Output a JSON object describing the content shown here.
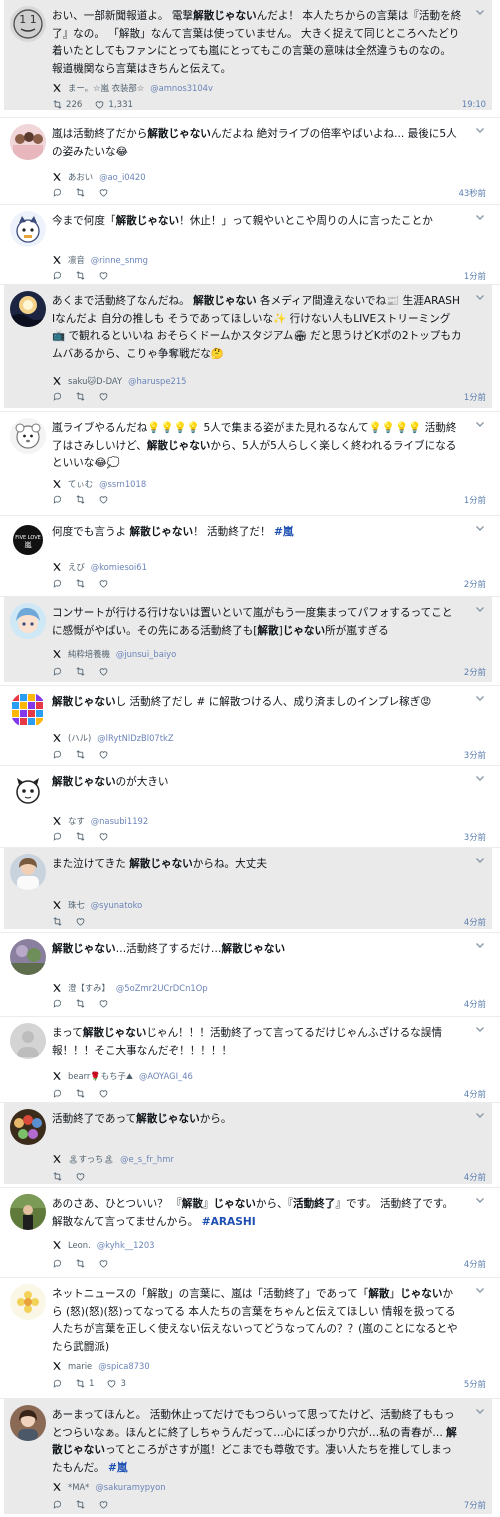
{
  "colors": {
    "shade": "#eaeaea",
    "link": "#1d4fb3",
    "handle": "#6b84b8",
    "time": "#5b7fb0",
    "muted": "#536471"
  },
  "posts": [
    {
      "shaded": true,
      "avatar_icon": "speech-face-avatar",
      "segments": [
        {
          "t": "おい、一部新聞報道よ。 電撃"
        },
        {
          "t": "解散じゃない",
          "b": true
        },
        {
          "t": "んだよ！ 本人たちからの言葉は『活動を終了』なの。 「解散」なんて言葉は使っていません。 大きく捉えて同じところへたどり着いたとしてもファンにとっても嵐にとってもこの言葉の意味は全然違うものなの。 報道機関なら言葉はきちんと伝えて。"
        }
      ],
      "name": "まー。☆嵐 衣装部☆",
      "handle": "@amnos3104v",
      "retweets": "226",
      "likes": "1,331",
      "time": "19:10",
      "show_reply": false
    },
    {
      "shaded": false,
      "avatar_icon": "group-photo-avatar",
      "segments": [
        {
          "t": "嵐は活動終了だから"
        },
        {
          "t": "解散じゃない",
          "b": true
        },
        {
          "t": "んだよね 絶対ライブの倍率やばいよね... 最後に5人の姿みたいな😂"
        }
      ],
      "name": "あおい",
      "handle": "@ao_i0420",
      "retweets": "",
      "likes": "",
      "time": "43秒前",
      "show_reply": true
    },
    {
      "shaded": false,
      "avatar_icon": "cartoon-character-avatar",
      "segments": [
        {
          "t": "今まで何度「"
        },
        {
          "t": "解散じゃない",
          "b": true
        },
        {
          "t": "！休止！」って親やいとこや周りの人に言ったことか"
        }
      ],
      "name": "凛音",
      "handle": "@rinne_snmg",
      "retweets": "",
      "likes": "",
      "time": "1分前",
      "show_reply": true
    },
    {
      "shaded": true,
      "avatar_icon": "sunset-silhouette-avatar",
      "segments": [
        {
          "t": "あくまで活動終了なんだね。 "
        },
        {
          "t": "解散じゃない",
          "b": true
        },
        {
          "t": " 各メディア間違えないでね📰 生涯ARASHIなんだよ 自分の推しも そうであってほしいな✨ 行けない人もLIVEストリーミング📺 で観れるといいね おそらくドームかスタジアム🏟 だと思うけどKポの2トップもカムバあるから、こりゃ争奪戦だな🤔"
        }
      ],
      "name": "saku🐱D-DAY",
      "handle": "@haruspe215",
      "retweets": "",
      "likes": "",
      "time": "1分前",
      "show_reply": true
    },
    {
      "shaded": false,
      "avatar_icon": "plush-character-avatar",
      "segments": [
        {
          "t": "嵐ライブやるんだね💡💡💡💡 5人で集まる姿がまた見れるなんて💡💡💡💡 活動終了はさみしいけど、"
        },
        {
          "t": "解散じゃない",
          "b": true
        },
        {
          "t": "から、5人が5人らしく楽しく終われるライブになるといいな😂💭"
        }
      ],
      "name": "てぃむ",
      "handle": "@ssrn1018",
      "retweets": "",
      "likes": "",
      "time": "1分前",
      "show_reply": true
    },
    {
      "shaded": false,
      "avatar_icon": "logo-text-avatar",
      "segments": [
        {
          "t": "何度でも言うよ "
        },
        {
          "t": "解散じゃない",
          "b": true
        },
        {
          "t": "！ 活動終了だ！ "
        },
        {
          "t": "#嵐",
          "l": true
        }
      ],
      "name": "えび",
      "handle": "@komiesoi61",
      "retweets": "",
      "likes": "",
      "time": "2分前",
      "show_reply": true
    },
    {
      "shaded": true,
      "avatar_icon": "anime-character-avatar",
      "segments": [
        {
          "t": "コンサートが行ける行けないは置いといて嵐がもう一度集まってパフォするってことに感慨がやばい。その先にある活動終了も["
        },
        {
          "t": "解散",
          "b": true
        },
        {
          "t": "]"
        },
        {
          "t": "じゃない",
          "b": true
        },
        {
          "t": "所が嵐すぎる"
        }
      ],
      "name": "純粋培養機",
      "handle": "@junsui_baiyo",
      "retweets": "",
      "likes": "",
      "time": "2分前",
      "show_reply": true
    },
    {
      "shaded": false,
      "avatar_icon": "color-grid-avatar",
      "segments": [
        {
          "t": "解散じゃない",
          "b": true
        },
        {
          "t": "し 活動終了だし # に解散つける人、成り済ましのインプレ稼ぎ😡"
        }
      ],
      "name": "(ハル)",
      "handle": "@lRytNlDzBl07tkZ",
      "retweets": "",
      "likes": "",
      "time": "3分前",
      "show_reply": true
    },
    {
      "shaded": false,
      "avatar_icon": "animal-sketch-avatar",
      "segments": [
        {
          "t": "解散じゃない",
          "b": true
        },
        {
          "t": "のが大きい"
        }
      ],
      "name": "なす",
      "handle": "@nasubi1192",
      "retweets": "",
      "likes": "",
      "time": "3分前",
      "show_reply": true
    },
    {
      "shaded": true,
      "avatar_icon": "person-photo-avatar",
      "segments": [
        {
          "t": "また泣けてきた "
        },
        {
          "t": "解散じゃない",
          "b": true
        },
        {
          "t": "からね。大丈夫"
        }
      ],
      "name": "珠七",
      "handle": "@syunatoko",
      "retweets": "",
      "likes": "",
      "time": "4分前",
      "show_reply": false
    },
    {
      "shaded": false,
      "avatar_icon": "nature-photo-avatar",
      "segments": [
        {
          "t": "解散じゃない",
          "b": true
        },
        {
          "t": "…活動終了するだけ…"
        },
        {
          "t": "解散じゃない",
          "b": true
        }
      ],
      "name": "澄【すみ】",
      "handle": "@5oZmr2UCrDCn1Op",
      "retweets": "",
      "likes": "",
      "time": "4分前",
      "show_reply": true
    },
    {
      "shaded": false,
      "avatar_icon": "default-gray-avatar",
      "segments": [
        {
          "t": "まって"
        },
        {
          "t": "解散じゃない",
          "b": true
        },
        {
          "t": "じゃん！！！活動終了って言ってるだけじゃんふざけるな誤情報！！！そこ大事なんだぞ！！！！！"
        }
      ],
      "name": "bearr🌹もち子⛰",
      "handle": "@AOYAGI_46",
      "retweets": "",
      "likes": "",
      "time": "4分前",
      "show_reply": true
    },
    {
      "shaded": true,
      "avatar_icon": "group-collage-avatar",
      "segments": [
        {
          "t": "活動終了であって"
        },
        {
          "t": "解散じゃない",
          "b": true
        },
        {
          "t": "から。"
        }
      ],
      "name": "🏝すっち🏝",
      "handle": "@e_s_fr_hmr",
      "retweets": "",
      "likes": "",
      "time": "4分前",
      "show_reply": false
    },
    {
      "shaded": false,
      "avatar_icon": "outdoor-photo-avatar",
      "segments": [
        {
          "t": "あのさあ、ひとついい？ 『"
        },
        {
          "t": "解散",
          "b": true
        },
        {
          "t": "』"
        },
        {
          "t": "じゃない",
          "b": true
        },
        {
          "t": "から、『"
        },
        {
          "t": "活動終了",
          "b": true
        },
        {
          "t": "』です。 活動終了です。 解散なんて言ってませんから。 "
        },
        {
          "t": "#ARASHI",
          "l": true
        }
      ],
      "name": "Leon.",
      "handle": "@kyhk__1203",
      "retweets": "",
      "likes": "",
      "time": "4分前",
      "show_reply": true
    },
    {
      "shaded": false,
      "avatar_icon": "flower-illustration-avatar",
      "segments": [
        {
          "t": "ネットニュースの「解散」の言葉に、嵐は「活動終了」であって「"
        },
        {
          "t": "解散",
          "b": true
        },
        {
          "t": "」"
        },
        {
          "t": "じゃない",
          "b": true
        },
        {
          "t": "から (怒)(怒)(怒)ってなってる 本人たちの言葉をちゃんと伝えてほしい 情報を扱ってる人たちが言葉を正しく使えない伝えないってどうなってんの？？(嵐のことになるとやたら武闘派)"
        }
      ],
      "name": "marie",
      "handle": "@spica8730",
      "retweets": "1",
      "likes": "3",
      "time": "5分前",
      "show_reply": true
    },
    {
      "shaded": true,
      "avatar_icon": "portrait-photo-avatar",
      "segments": [
        {
          "t": "あーまってほんと。 活動休止ってだけでもつらいって思ってたけど、活動終了ももっとつらいなぁ。ほんとに終了しちゃうんだって…心にぽっかり穴が…私の青春が… "
        },
        {
          "t": "解散じゃない",
          "b": true
        },
        {
          "t": "ってところがさすが嵐！どこまでも尊敬です。凄い人たちを推してしまったもんだ。 "
        },
        {
          "t": "#嵐",
          "l": true
        }
      ],
      "name": "*MA*",
      "handle": "@sakuramypyon",
      "retweets": "",
      "likes": "",
      "time": "7分前",
      "show_reply": true
    }
  ]
}
